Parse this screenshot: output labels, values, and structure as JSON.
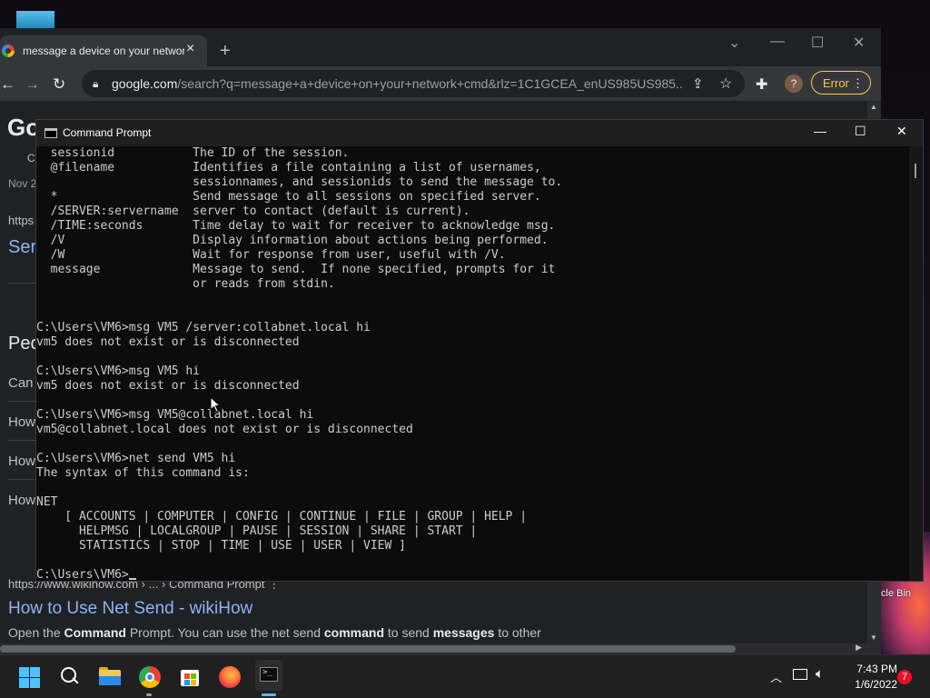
{
  "browser": {
    "tab_title": "message a device on your network",
    "new_tab": "+",
    "url_host": "google.com",
    "url_path": "/search?q=message+a+device+on+your+network+cmd&rlz=1C1GCEA_enUS985US985...",
    "profile_initial": "?",
    "error_label": "Error",
    "menu": "⋮"
  },
  "page": {
    "logo_fragment": "Go",
    "frag_c": "C",
    "frag_date": "Nov 2",
    "frag_https": "https",
    "frag_ser": "Ser",
    "frag_pe": "Peo",
    "frag_can": "Can",
    "frag_how1": "How",
    "frag_how2": "How",
    "frag_how3": "How",
    "result_url": "https://www.wikihow.com › ... › Command Prompt   ⋮",
    "result_title": "How to Use Net Send - wikiHow",
    "result_snippet_parts": [
      "Open the ",
      "Command",
      " Prompt. You can use the net send ",
      "command",
      " to send ",
      "messages",
      " to other"
    ]
  },
  "cmd": {
    "title": "Command Prompt",
    "lines": [
      "  sessionid           The ID of the session.",
      "  @filename           Identifies a file containing a list of usernames,",
      "                      sessionnames, and sessionids to send the message to.",
      "  *                   Send message to all sessions on specified server.",
      "  /SERVER:servername  server to contact (default is current).",
      "  /TIME:seconds       Time delay to wait for receiver to acknowledge msg.",
      "  /V                  Display information about actions being performed.",
      "  /W                  Wait for response from user, useful with /V.",
      "  message             Message to send.  If none specified, prompts for it",
      "                      or reads from stdin.",
      "",
      "",
      "C:\\Users\\VM6>msg VM5 /server:collabnet.local hi",
      "vm5 does not exist or is disconnected",
      "",
      "C:\\Users\\VM6>msg VM5 hi",
      "vm5 does not exist or is disconnected",
      "",
      "C:\\Users\\VM6>msg VM5@collabnet.local hi",
      "vm5@collabnet.local does not exist or is disconnected",
      "",
      "C:\\Users\\VM6>net send VM5 hi",
      "The syntax of this command is:",
      "",
      "NET",
      "    [ ACCOUNTS | COMPUTER | CONFIG | CONTINUE | FILE | GROUP | HELP |",
      "      HELPMSG | LOCALGROUP | PAUSE | SESSION | SHARE | START |",
      "      STATISTICS | STOP | TIME | USE | USER | VIEW ]",
      "",
      "C:\\Users\\VM6>"
    ]
  },
  "desktop": {
    "recycle_label": "cle Bin"
  },
  "taskbar": {
    "time": "7:43 PM",
    "date": "1/6/2022",
    "notifications": "7"
  }
}
